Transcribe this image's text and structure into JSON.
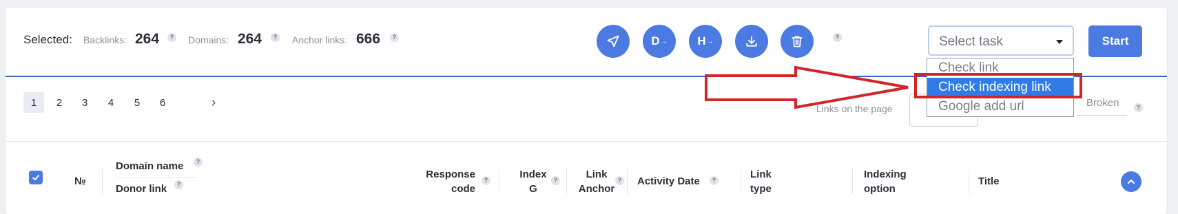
{
  "stats": {
    "selected_label": "Selected:",
    "backlinks_label": "Backlinks:",
    "backlinks_value": "264",
    "domains_label": "Domains:",
    "domains_value": "264",
    "anchor_label": "Anchor links:",
    "anchor_value": "666"
  },
  "help_glyph": "?",
  "toolbar": {
    "buttons": [
      {
        "name": "send",
        "icon": "paper-plane-icon"
      },
      {
        "name": "domain-action",
        "icon": "d-arrow-icon",
        "letter": "D"
      },
      {
        "name": "host-action",
        "icon": "h-arrow-icon",
        "letter": "H"
      },
      {
        "name": "download",
        "icon": "download-icon"
      },
      {
        "name": "delete",
        "icon": "trash-icon"
      }
    ],
    "arrow_glyph": "→"
  },
  "task_select": {
    "placeholder": "Select task",
    "options": [
      "Check link",
      "Check indexing link",
      "Google add url"
    ],
    "highlighted_index": 1
  },
  "start_label": "Start",
  "pagination": {
    "pages": [
      "1",
      "2",
      "3",
      "4",
      "5",
      "6"
    ],
    "active": "1",
    "next_glyph": "›"
  },
  "filters": {
    "links_on_page_label": "Links on the page",
    "broken_label": "Broken"
  },
  "table": {
    "number_header": "№",
    "domain_name_header": "Domain name",
    "donor_link_header": "Donor link",
    "response_code_header": [
      "Response",
      "code"
    ],
    "index_g_header": [
      "Index",
      "G"
    ],
    "link_anchor_header": [
      "Link",
      "Anchor"
    ],
    "activity_date_header": "Activity Date",
    "link_type_header": [
      "Link",
      "type"
    ],
    "indexing_option_header": [
      "Indexing",
      "option"
    ],
    "title_header": "Title"
  },
  "colors": {
    "accent": "#4a7ae2",
    "highlight_option": "#2f7ce8",
    "annotation_red": "#d1242b"
  }
}
